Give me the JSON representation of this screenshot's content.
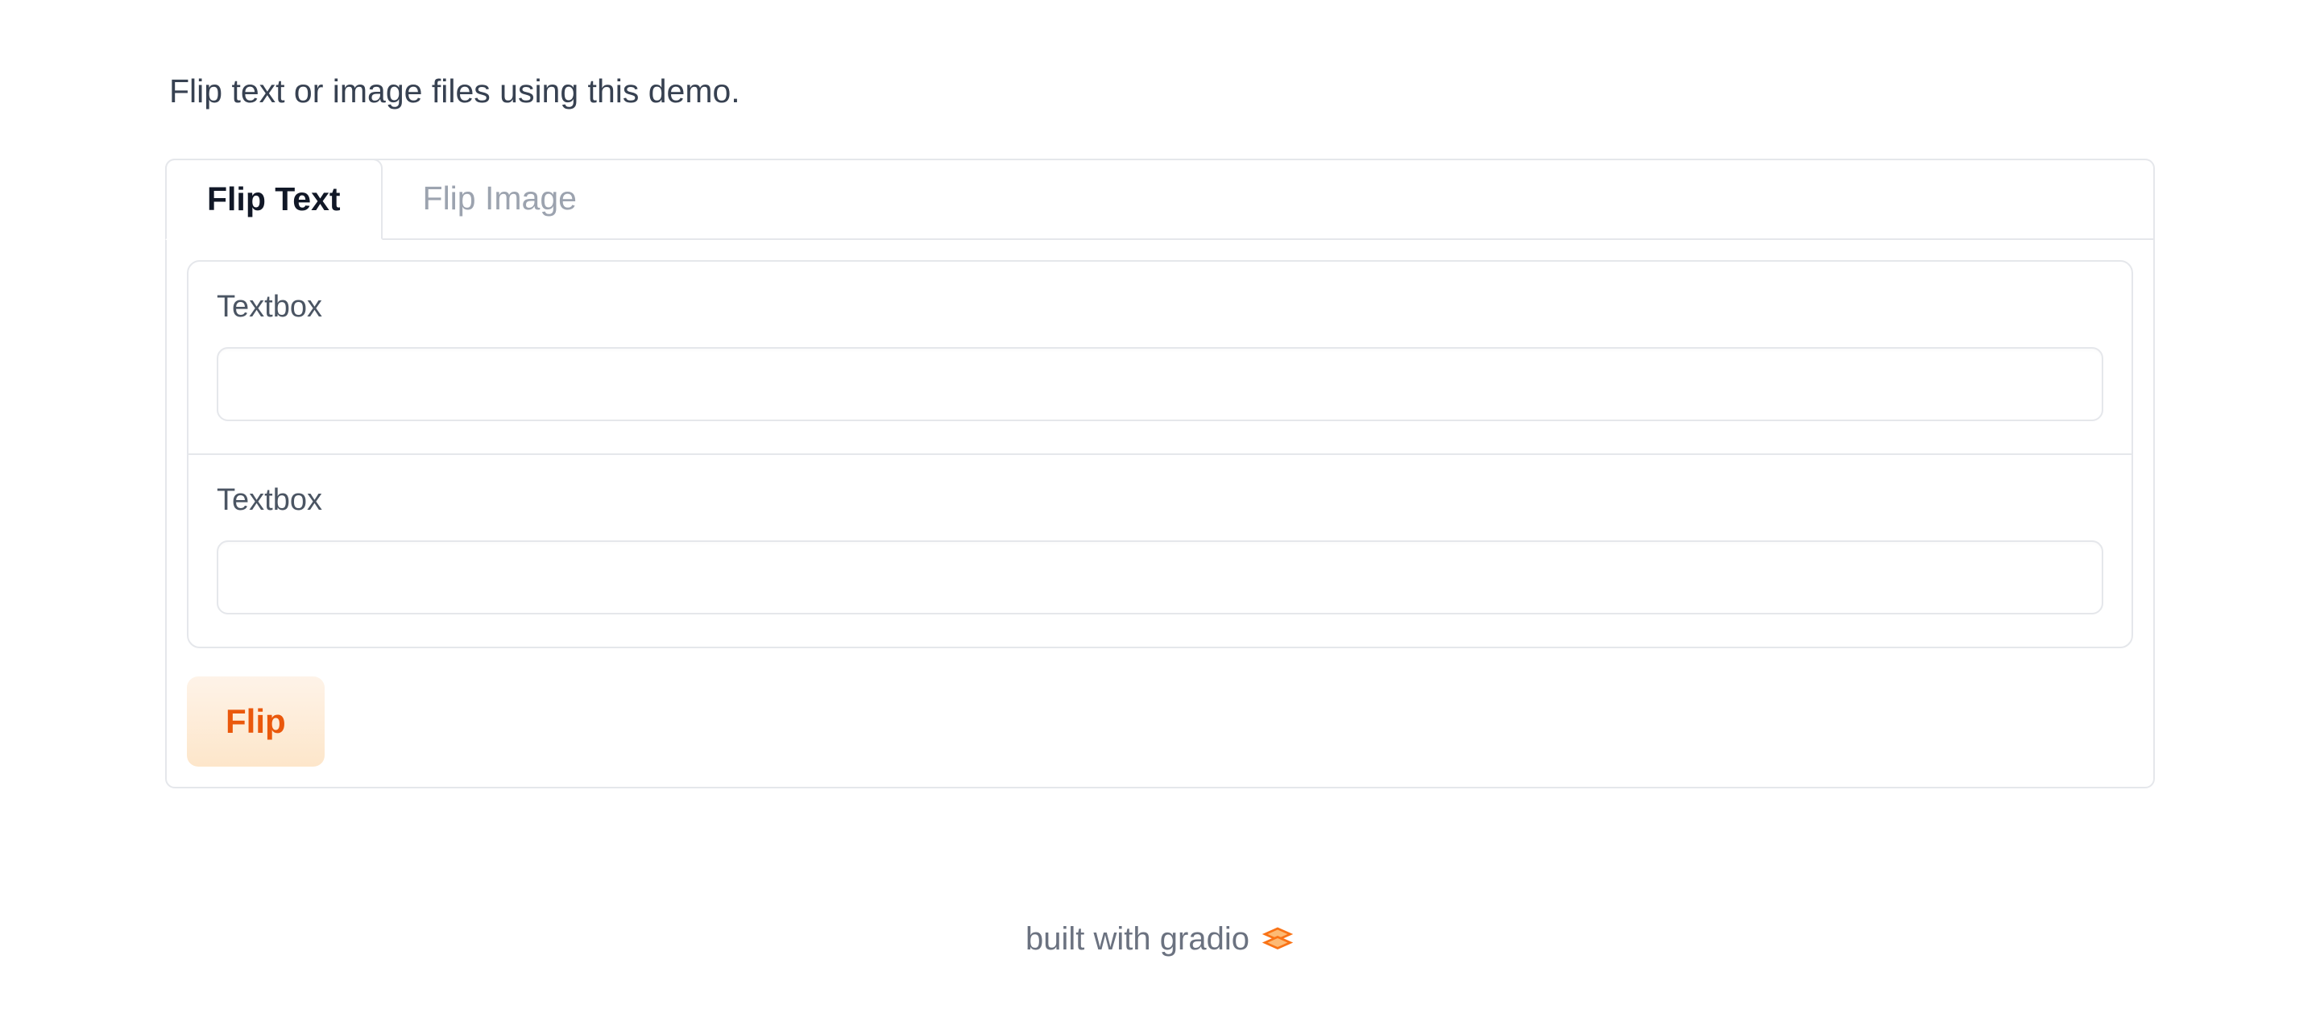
{
  "description": "Flip text or image files using this demo.",
  "tabs": {
    "active": {
      "label": "Flip Text"
    },
    "inactive": {
      "label": "Flip Image"
    }
  },
  "fields": {
    "input": {
      "label": "Textbox",
      "value": ""
    },
    "output": {
      "label": "Textbox",
      "value": ""
    }
  },
  "button": {
    "label": "Flip"
  },
  "footer": {
    "text": "built with gradio"
  }
}
